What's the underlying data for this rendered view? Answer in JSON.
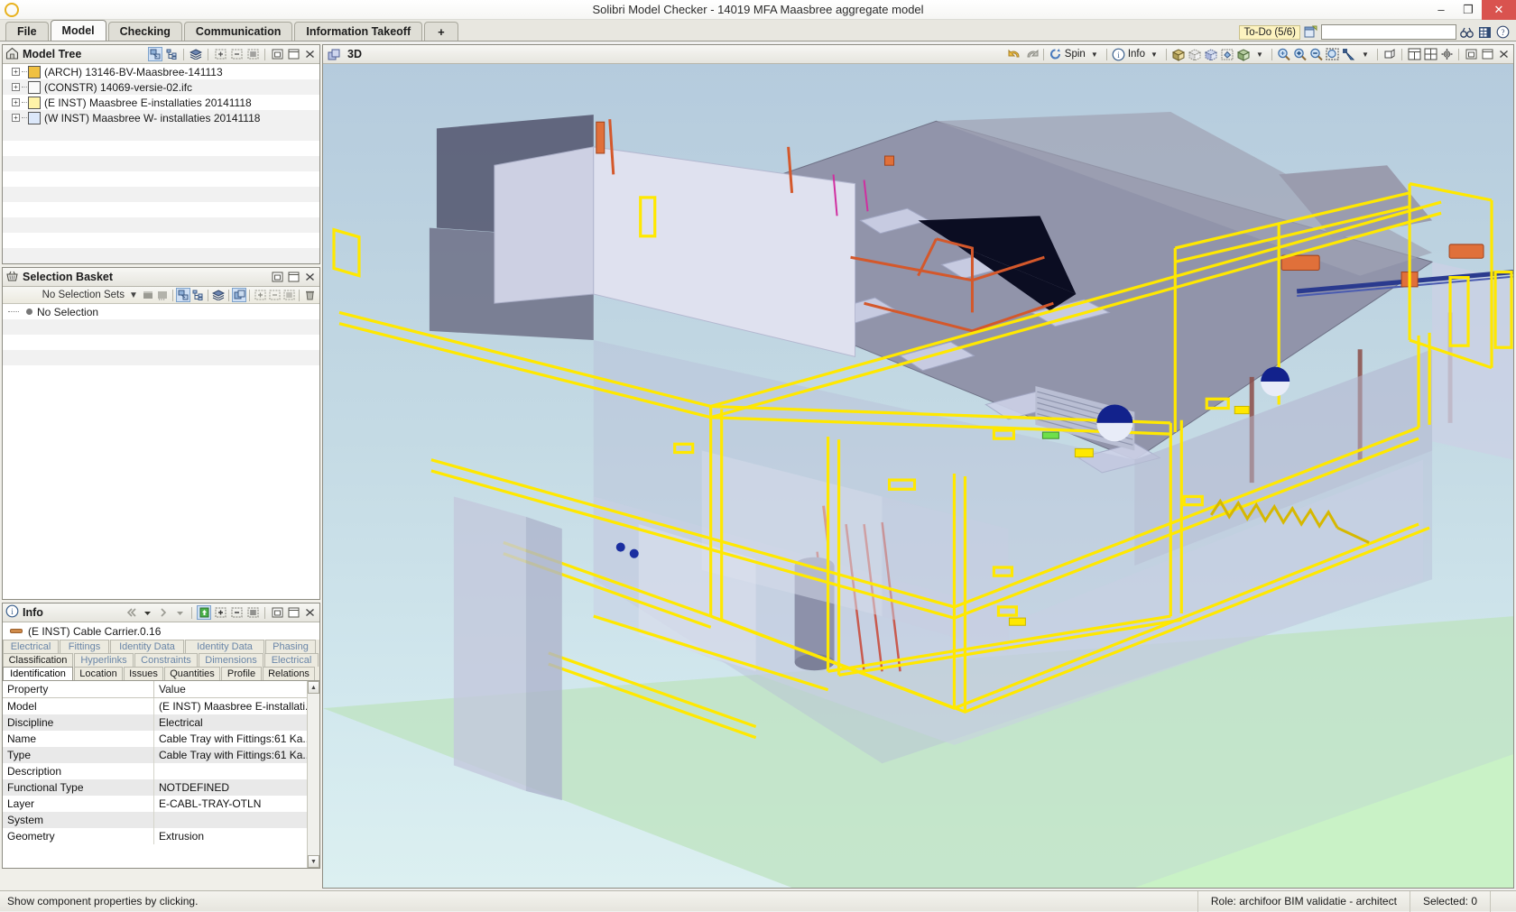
{
  "window": {
    "title": "Solibri Model Checker - 14019 MFA Maasbree aggregate model",
    "logo_icon": "solibri-logo-icon",
    "minimize_label": "–",
    "maximize_label": "❐",
    "close_label": "✕"
  },
  "ribbon": {
    "tabs": [
      {
        "label": "File",
        "active": false
      },
      {
        "label": "Model",
        "active": true
      },
      {
        "label": "Checking",
        "active": false
      },
      {
        "label": "Communication",
        "active": false
      },
      {
        "label": "Information Takeoff",
        "active": false
      },
      {
        "label": "+",
        "active": false
      }
    ],
    "todo_badge": "To-Do (5/6)",
    "todo_icon": "todo-layout-icon",
    "search_value": "",
    "search_placeholder": "",
    "find_icon": "binoculars-icon",
    "film_icon": "film-icon",
    "help_icon": "question-circle-icon"
  },
  "model_tree": {
    "title": "Model Tree",
    "home_icon": "house-icon",
    "tools": [
      {
        "name": "select-hierarchy-icon",
        "selected": true
      },
      {
        "name": "tree-structure-icon",
        "selected": false
      },
      {
        "name": "layers-icon",
        "selected": false
      },
      {
        "name": "expand-all-icon",
        "selected": false
      },
      {
        "name": "collapse-all-icon",
        "selected": false
      },
      {
        "name": "list-view-icon",
        "selected": false
      },
      {
        "name": "restore-panel-icon",
        "selected": false
      },
      {
        "name": "maximize-panel-icon",
        "selected": false
      },
      {
        "name": "close-panel-icon",
        "selected": false
      }
    ],
    "items": [
      {
        "label": "(ARCH) 13146-BV-Maasbree-141113",
        "icon": "arch-model-icon"
      },
      {
        "label": "(CONSTR) 14069-versie-02.ifc",
        "icon": "constr-model-icon"
      },
      {
        "label": "(E INST) Maasbree E-installaties 20141118",
        "icon": "electrical-model-icon"
      },
      {
        "label": "(W INST) Maasbree W- installaties 20141118",
        "icon": "plumbing-model-icon"
      }
    ]
  },
  "selection_basket": {
    "title": "Selection Basket",
    "basket_icon": "basket-icon",
    "selection_sets_label": "No Selection Sets",
    "dropdown_icon": "chevron-down-icon",
    "content_label": "No Selection",
    "tools": [
      {
        "name": "add-to-basket-icon",
        "selected": false
      },
      {
        "name": "remove-from-basket-icon",
        "selected": false
      },
      {
        "name": "select-hierarchy-icon",
        "selected": true
      },
      {
        "name": "tree-structure-icon",
        "selected": false
      },
      {
        "name": "layers-icon",
        "selected": false
      },
      {
        "name": "basket-select-icon",
        "selected": true
      },
      {
        "name": "expand-all-icon",
        "selected": false
      },
      {
        "name": "collapse-all-icon",
        "selected": false
      },
      {
        "name": "list-view-icon",
        "selected": false
      },
      {
        "name": "delete-icon",
        "selected": false
      }
    ]
  },
  "info": {
    "title": "Info",
    "info_icon": "info-circle-icon",
    "prev_icon": "previous-double-arrow-icon",
    "prev_dropdown_icon": "chevron-down-icon",
    "next_icon": "next-double-arrow-icon",
    "next_dropdown_icon": "chevron-down-icon",
    "refresh_icon": "refresh-green-icon",
    "expand_icon": "expand-all-icon",
    "collapse_icon": "collapse-all-icon",
    "list_icon": "list-view-icon",
    "restore_icon": "restore-panel-icon",
    "maximize_icon": "maximize-panel-icon",
    "close_icon": "close-panel-icon",
    "selected_object": "(E INST) Cable Carrier.0.16",
    "selected_object_icon": "cable-carrier-icon",
    "tab_rows": [
      [
        {
          "label": "Electrical",
          "active": false
        },
        {
          "label": "Fittings",
          "active": false
        },
        {
          "label": "Identity Data",
          "active": false
        },
        {
          "label": "Identity Data",
          "active": false
        },
        {
          "label": "Phasing",
          "active": false
        }
      ],
      [
        {
          "label": "Classification",
          "active": false,
          "dark": true
        },
        {
          "label": "Hyperlinks",
          "active": false
        },
        {
          "label": "Constraints",
          "active": false
        },
        {
          "label": "Dimensions",
          "active": false
        },
        {
          "label": "Electrical",
          "active": false
        }
      ],
      [
        {
          "label": "Identification",
          "active": true
        },
        {
          "label": "Location",
          "active": false,
          "dark": true
        },
        {
          "label": "Issues",
          "active": false,
          "dark": true
        },
        {
          "label": "Quantities",
          "active": false,
          "dark": true
        },
        {
          "label": "Profile",
          "active": false,
          "dark": true
        },
        {
          "label": "Relations",
          "active": false,
          "dark": true
        }
      ]
    ],
    "table": {
      "columns": [
        "Property",
        "Value"
      ],
      "rows": [
        {
          "property": "Model",
          "value": "(E INST) Maasbree E-installati..."
        },
        {
          "property": "Discipline",
          "value": "Electrical"
        },
        {
          "property": "Name",
          "value": "Cable Tray with Fittings:61 Ka..."
        },
        {
          "property": "Type",
          "value": "Cable Tray with Fittings:61 Ka..."
        },
        {
          "property": "Description",
          "value": ""
        },
        {
          "property": "Functional Type",
          "value": "NOTDEFINED"
        },
        {
          "property": "Layer",
          "value": "E-CABL-TRAY-OTLN"
        },
        {
          "property": "System",
          "value": ""
        },
        {
          "property": "Geometry",
          "value": "Extrusion"
        }
      ],
      "scroll_up_icon": "scroll-up-arrow-icon",
      "scroll_down_icon": "scroll-down-arrow-icon"
    }
  },
  "view3d": {
    "title": "3D",
    "view_icon": "3d-view-icon",
    "undo_icon": "undo-arrow-icon",
    "redo_icon": "redo-arrow-icon",
    "spin_icon": "spin-icon",
    "spin_label": "Spin",
    "spin_dropdown_icon": "chevron-down-icon",
    "info_icon": "info-circle-icon",
    "info_label": "Info",
    "info_dropdown_icon": "chevron-down-icon",
    "solid-view_icon": "solid-cube-icon",
    "transparent_icon": "transparent-cube-icon",
    "wireframe_icon": "wireframe-cube-icon",
    "paint_icon": "paint-bucket-cube-icon",
    "shade_icon": "shaded-cube-icon",
    "shade_dropdown_icon": "chevron-down-icon",
    "zoom_fit_icon": "zoom-fit-icon",
    "zoom_in_icon": "zoom-in-icon",
    "zoom_out_icon": "zoom-out-icon",
    "zoom_area_icon": "zoom-area-icon",
    "pick_icon": "pick-arrow-icon",
    "pick_dropdown_icon": "chevron-down-icon",
    "section_icon": "section-box-icon",
    "layout1_icon": "layout-split-icon",
    "layout2_icon": "layout-grid-icon",
    "settings_icon": "settings-icon",
    "restore_icon": "restore-panel-icon",
    "maximize_icon": "maximize-panel-icon",
    "close_icon": "close-panel-icon"
  },
  "statusbar": {
    "hint": "Show component properties by clicking.",
    "role": "Role: archifoor BIM validatie - architect",
    "selected": "Selected: 0"
  }
}
